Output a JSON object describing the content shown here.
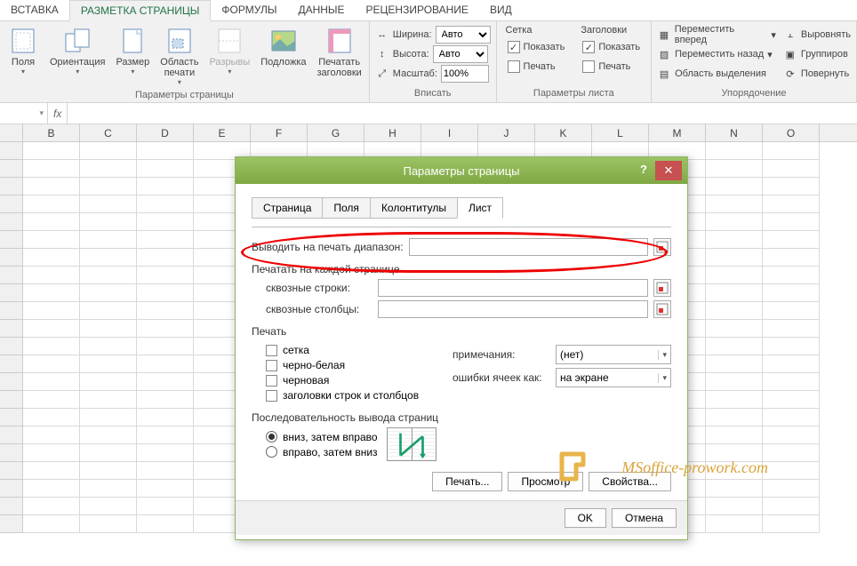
{
  "ribbon": {
    "tabs": [
      "ВСТАВКА",
      "РАЗМЕТКА СТРАНИЦЫ",
      "ФОРМУЛЫ",
      "ДАННЫЕ",
      "РЕЦЕНЗИРОВАНИЕ",
      "ВИД"
    ],
    "active_tab": 1,
    "groups": {
      "page_setup": {
        "label": "Параметры страницы",
        "margins": "Поля",
        "orientation": "Ориентация",
        "size": "Размер",
        "print_area": "Область печати",
        "breaks": "Разрывы",
        "background": "Подложка",
        "print_titles": "Печатать заголовки"
      },
      "scale": {
        "label": "Вписать",
        "width_label": "Ширина:",
        "height_label": "Высота:",
        "scale_label": "Масштаб:",
        "width_value": "Авто",
        "height_value": "Авто",
        "scale_value": "100%"
      },
      "sheet_options": {
        "label": "Параметры листа",
        "gridlines": "Сетка",
        "headings": "Заголовки",
        "show": "Показать",
        "print": "Печать",
        "gridlines_show": true,
        "gridlines_print": false,
        "headings_show": true,
        "headings_print": false
      },
      "arrange": {
        "label": "Упорядочение",
        "bring_forward": "Переместить вперед",
        "send_backward": "Переместить назад",
        "selection_pane": "Область выделения",
        "align": "Выровнять",
        "group": "Группиров",
        "rotate": "Повернуть"
      }
    }
  },
  "formula_bar": {
    "fx": "fx",
    "name_box": ""
  },
  "columns": [
    "B",
    "C",
    "D",
    "E",
    "F",
    "G",
    "H",
    "I",
    "J",
    "K",
    "L",
    "M",
    "N",
    "O"
  ],
  "rows_count": 22,
  "dialog": {
    "title": "Параметры страницы",
    "help": "?",
    "tabs": [
      "Страница",
      "Поля",
      "Колонтитулы",
      "Лист"
    ],
    "active_tab": 3,
    "print_range_label": "Выводить на печать диапазон:",
    "every_page_label": "Печатать на каждой странице",
    "through_rows_label": "сквозные строки:",
    "through_cols_label": "сквозные столбцы:",
    "print_section": "Печать",
    "chk_grid": "сетка",
    "chk_bw": "черно-белая",
    "chk_draft": "черновая",
    "chk_rowcol": "заголовки строк и столбцов",
    "notes_label": "примечания:",
    "notes_value": "(нет)",
    "errors_label": "ошибки ячеек как:",
    "errors_value": "на экране",
    "order_section": "Последовательность вывода страниц",
    "order_down": "вниз, затем вправо",
    "order_across": "вправо, затем вниз",
    "order_selected": "down",
    "btn_print": "Печать...",
    "btn_preview": "Просмотр",
    "btn_props": "Свойства...",
    "btn_ok": "OK",
    "btn_cancel": "Отмена"
  },
  "watermark": "MSoffice-prowork.com"
}
